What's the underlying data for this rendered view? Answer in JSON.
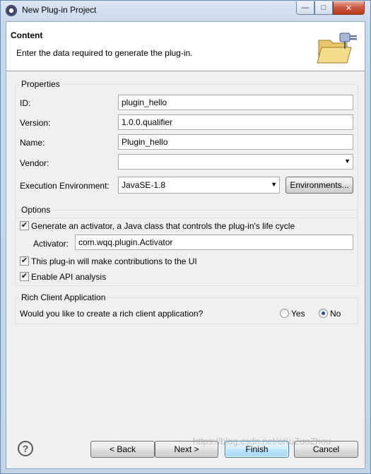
{
  "window": {
    "title": "New Plug-in Project",
    "controls": {
      "minimize": "—",
      "maximize": "□",
      "close": "✕"
    }
  },
  "header": {
    "title": "Content",
    "description": "Enter the data required to generate the plug-in.",
    "icon": "wizard-folder-plug-icon"
  },
  "properties": {
    "group_label": "Properties",
    "id_label": "ID:",
    "id_value": "plugin_hello",
    "version_label": "Version:",
    "version_value": "1.0.0.qualifier",
    "name_label": "Name:",
    "name_value": "Plugin_hello",
    "vendor_label": "Vendor:",
    "vendor_value": "",
    "env_label": "Execution Environment:",
    "env_value": "JavaSE-1.8",
    "env_button": "Environments..."
  },
  "options": {
    "group_label": "Options",
    "activator_checkbox": {
      "label": "Generate an activator, a Java class that controls the plug-in's life cycle",
      "checked": true
    },
    "activator_label": "Activator:",
    "activator_value": "com.wqq.plugin.Activator",
    "ui_checkbox": {
      "label": "This plug-in will make contributions to the UI",
      "checked": true
    },
    "api_checkbox": {
      "label": "Enable API analysis",
      "checked": true
    }
  },
  "rca": {
    "group_label": "Rich Client Application",
    "question": "Would you like to create a rich client application?",
    "yes_label": "Yes",
    "no_label": "No",
    "selected": "No"
  },
  "footer": {
    "help_icon": "help-icon",
    "back": "< Back",
    "next": "Next >",
    "finish": "Finish",
    "cancel": "Cancel"
  },
  "watermark": "https://blog.csdn.net/oKuZuoZhou"
}
